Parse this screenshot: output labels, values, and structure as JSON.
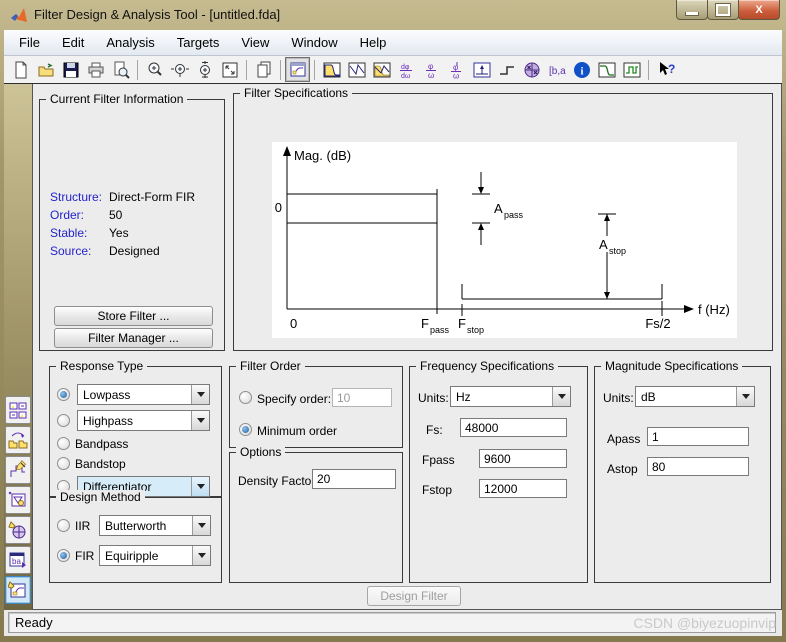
{
  "window": {
    "title": "Filter Design & Analysis Tool - [untitled.fda]",
    "status": "Ready",
    "watermark": "CSDN @biyezuopinvip"
  },
  "menu": {
    "items": [
      "File",
      "Edit",
      "Analysis",
      "Targets",
      "View",
      "Window",
      "Help"
    ]
  },
  "toolbar": {
    "icons": [
      "new",
      "open",
      "save",
      "print",
      "print-preview",
      "zoom-in",
      "zoom-x",
      "zoom-y",
      "full-view",
      "copy-session",
      "filter-design",
      "magnitude-response",
      "phase-response",
      "magnitude-phase-response",
      "group-delay",
      "phase-delay",
      "zero-phase",
      "impulse-response",
      "step-response",
      "pole-zero",
      "coefficients",
      "filter-info",
      "design-mask",
      "realize-model",
      "help"
    ]
  },
  "sidebar": {
    "icons": [
      "multirate-filter",
      "transform-filter",
      "quantization-parameters",
      "frequency-transformations",
      "pole-zero-editor",
      "import-filter",
      "design-filter"
    ],
    "selected": "design-filter"
  },
  "current_filter_info": {
    "title": "Current Filter Information",
    "rows": [
      {
        "label": "Structure:",
        "value": "Direct-Form FIR"
      },
      {
        "label": "Order:",
        "value": "50"
      },
      {
        "label": "Stable:",
        "value": "Yes"
      },
      {
        "label": "Source:",
        "value": "Designed"
      }
    ],
    "store_button": "Store Filter ...",
    "manager_button": "Filter Manager ..."
  },
  "filter_specifications": {
    "title": "Filter Specifications",
    "diagram": {
      "y_axis": "Mag. (dB)",
      "x_axis": "f (Hz)",
      "y_zero": "0",
      "x_zero": "0",
      "fpass_main": "F",
      "fpass_sub": "pass",
      "fstop_main": "F",
      "fstop_sub": "stop",
      "fs_half": "Fs/2",
      "apass_main": "A",
      "apass_sub": "pass",
      "astop_main": "A",
      "astop_sub": "stop"
    }
  },
  "response_type": {
    "title": "Response Type",
    "lowpass": "Lowpass",
    "highpass": "Highpass",
    "bandpass": "Bandpass",
    "bandstop": "Bandstop",
    "differentiator": "Differentiator",
    "selected": "Lowpass"
  },
  "design_method": {
    "title": "Design Method",
    "iir_label": "IIR",
    "iir_value": "Butterworth",
    "fir_label": "FIR",
    "fir_value": "Equiripple",
    "selected": "FIR"
  },
  "filter_order": {
    "title": "Filter Order",
    "specify_label": "Specify order:",
    "specify_value": "10",
    "minimum_label": "Minimum order",
    "selected": "minimum"
  },
  "options_panel": {
    "title": "Options",
    "density_label": "Density Factor:",
    "density_value": "20"
  },
  "frequency_specifications": {
    "title": "Frequency Specifications",
    "units_label": "Units:",
    "units_value": "Hz",
    "fs_label": "Fs:",
    "fs_value": "48000",
    "fpass_label": "Fpass",
    "fpass_value": "9600",
    "fstop_label": "Fstop",
    "fstop_value": "12000"
  },
  "magnitude_specifications": {
    "title": "Magnitude Specifications",
    "units_label": "Units:",
    "units_value": "dB",
    "apass_label": "Apass",
    "apass_value": "1",
    "astop_label": "Astop",
    "astop_value": "80"
  },
  "design_filter_button": "Design Filter",
  "colors": {
    "frame": "#a2976a",
    "accent_blue": "#2424cc",
    "dropdown_highlight": "#d7ecf9",
    "info_icon": "#1050c8",
    "close_button": "#cb5c39"
  }
}
